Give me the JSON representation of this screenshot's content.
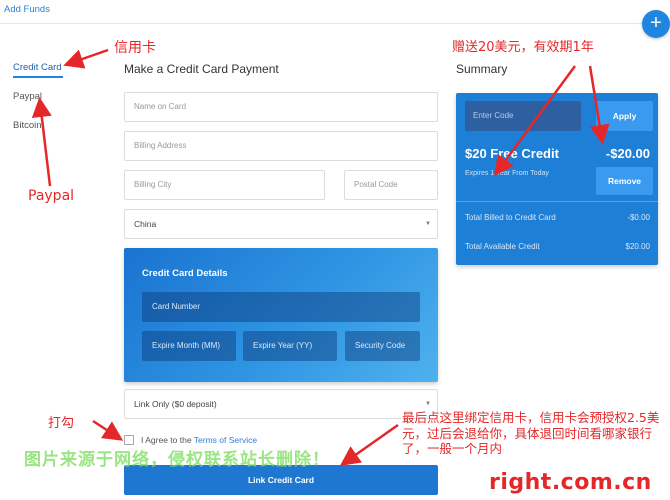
{
  "header": {
    "tab_label": "Add Funds",
    "add_button": "+"
  },
  "sidebar": {
    "items": [
      {
        "label": "Credit Card",
        "active": true
      },
      {
        "label": "Paypal",
        "active": false
      },
      {
        "label": "Bitcoin",
        "active": false
      }
    ]
  },
  "form": {
    "title": "Make a Credit Card Payment",
    "name_placeholder": "Name on Card",
    "address_placeholder": "Billing Address",
    "city_placeholder": "Billing City",
    "postal_placeholder": "Postal Code",
    "country_value": "China",
    "card_details": {
      "title": "Credit Card Details",
      "number_placeholder": "Card Number",
      "month_placeholder": "Expire Month (MM)",
      "year_placeholder": "Expire Year (YY)",
      "cvc_placeholder": "Security Code"
    },
    "deposit_option": "Link Only ($0 deposit)",
    "terms_prefix": "I Agree to the",
    "terms_link": "Terms of Service",
    "submit_label": "Link Credit Card"
  },
  "summary": {
    "title": "Summary",
    "code_placeholder": "Enter Code",
    "apply_label": "Apply",
    "credit_title": "$20 Free Credit",
    "credit_amount": "-$20.00",
    "credit_expiry": "Expires 1 Year From Today",
    "remove_label": "Remove",
    "billed_label": "Total Billed to Credit Card",
    "billed_value": "-$0.00",
    "available_label": "Total Available Credit",
    "available_value": "$20.00"
  },
  "annotations": {
    "credit_card": "信用卡",
    "paypal": "Paypal",
    "free_credit": "赠送20美元，有效期1年",
    "check": "打勾",
    "bottom_note": "最后点这里绑定信用卡，信用卡会预授权2.5美元，过后会退给你，具体退回时间看哪家银行了，一般一个月内"
  },
  "watermark": {
    "text": "图片来源于网络，侵权联系站长删除！",
    "brand": "right.com.cn"
  },
  "colors": {
    "accent": "#1e86e0",
    "panel": "#1e7fd6",
    "annotation": "#e4282a",
    "watermark": "#78dc5a"
  }
}
